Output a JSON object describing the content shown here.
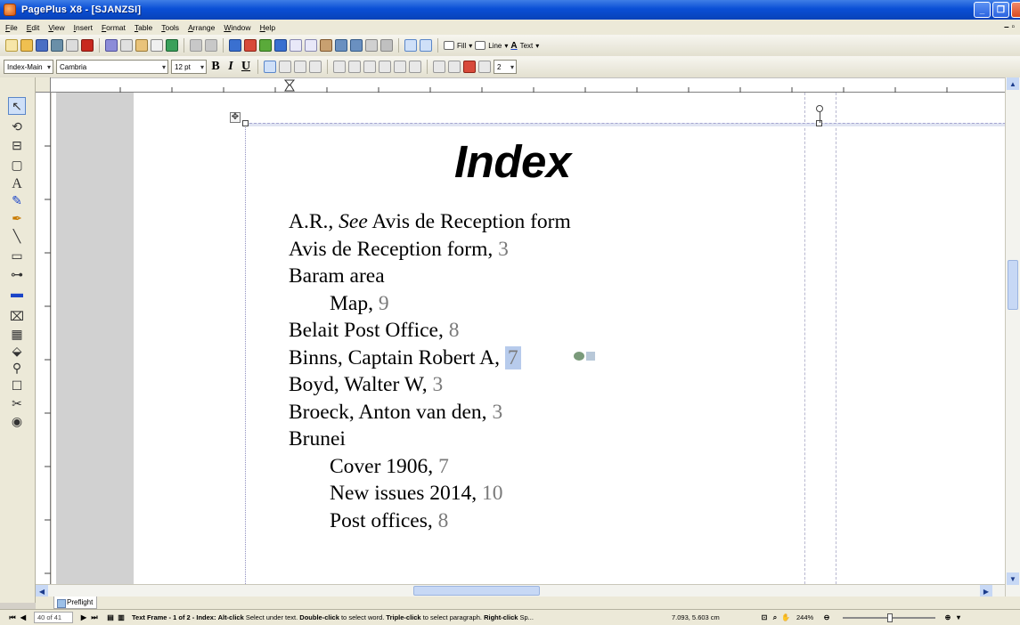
{
  "window": {
    "title": "PagePlus X8 - [SJANZSI]"
  },
  "menu": [
    "File",
    "Edit",
    "View",
    "Insert",
    "Format",
    "Table",
    "Tools",
    "Arrange",
    "Window",
    "Help"
  ],
  "toolbar": {
    "fill_label": "Fill",
    "line_label": "Line",
    "text_label": "Text",
    "text_style": "Index-Main",
    "font_name": "Cambria",
    "font_size": "12 pt",
    "bold": "B",
    "italic": "I",
    "underline": "U",
    "columns_value": "2"
  },
  "document": {
    "heading": "Index",
    "entries": [
      {
        "text": "A.R., ",
        "see": "See",
        "after": " Avis de Reception form",
        "page": "",
        "indent": false
      },
      {
        "text": "Avis de Reception form, ",
        "page": "3",
        "indent": false
      },
      {
        "text": "Baram area",
        "page": "",
        "indent": false
      },
      {
        "text": "Map, ",
        "page": "9",
        "indent": true
      },
      {
        "text": "Belait Post Office, ",
        "page": "8",
        "indent": false
      },
      {
        "text": "Binns, Captain Robert A, ",
        "page": "7",
        "indent": false,
        "selected": true
      },
      {
        "text": "Boyd, Walter W, ",
        "page": "3",
        "indent": false
      },
      {
        "text": "Broeck, Anton van den, ",
        "page": "3",
        "indent": false
      },
      {
        "text": "Brunei",
        "page": "",
        "indent": false
      },
      {
        "text": "Cover 1906, ",
        "page": "7",
        "indent": true
      },
      {
        "text": "New issues 2014, ",
        "page": "10",
        "indent": true
      },
      {
        "text": "Post offices, ",
        "page": "8",
        "indent": true
      }
    ]
  },
  "preflight": {
    "label": "Preflight"
  },
  "status": {
    "page_indicator": "40 of 41",
    "frame_info": "Text Frame - 1 of 2 - Index:",
    "hint_1_key": "Alt-click",
    "hint_1": " Select under text. ",
    "hint_2_key": "Double-click",
    "hint_2": " to select word. ",
    "hint_3_key": "Triple-click",
    "hint_3": " to select paragraph. ",
    "hint_4_key": "Right-click",
    "hint_4": " Sp...",
    "coordinates": "7.093, 5.603 cm",
    "zoom": "244%"
  },
  "colors": {
    "titlebar": "#0a4fd6",
    "chrome": "#ece9d8",
    "selection": "#b7cbec",
    "page_number": "#7a7a7a"
  }
}
